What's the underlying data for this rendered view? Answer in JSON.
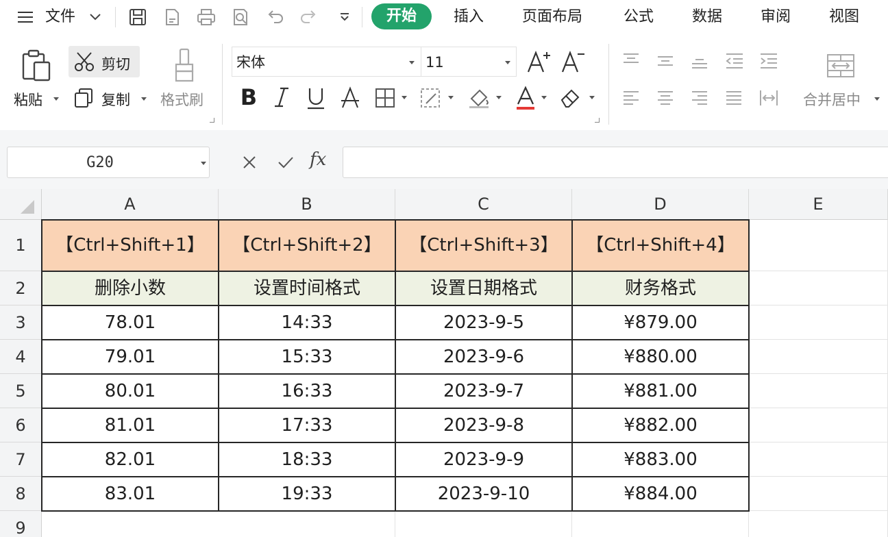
{
  "menu": {
    "file_label": "文件",
    "tabs": [
      "开始",
      "插入",
      "页面布局",
      "公式",
      "数据",
      "审阅",
      "视图"
    ],
    "active_tab": "开始"
  },
  "ribbon": {
    "paste_label": "粘贴",
    "cut_label": "剪切",
    "copy_label": "复制",
    "format_painter_label": "格式刷",
    "font_name": "宋体",
    "font_size": "11",
    "merge_label": "合并居中",
    "font_color": "#e53935",
    "accent": "#23a36b"
  },
  "formula_bar": {
    "cell_ref": "G20",
    "fx_label": "fx",
    "value": ""
  },
  "sheet": {
    "columns": [
      "A",
      "B",
      "C",
      "D",
      "E"
    ],
    "rows": [
      "1",
      "2",
      "3",
      "4",
      "5",
      "6",
      "7",
      "8",
      "9"
    ],
    "header_row": [
      "【Ctrl+Shift+1】",
      "【Ctrl+Shift+2】",
      "【Ctrl+Shift+3】",
      "【Ctrl+Shift+4】"
    ],
    "subheader_row": [
      "删除小数",
      "设置时间格式",
      "设置日期格式",
      "财务格式"
    ],
    "data_rows": [
      [
        "78.01",
        "14:33",
        "2023-9-5",
        "¥879.00"
      ],
      [
        "79.01",
        "15:33",
        "2023-9-6",
        "¥880.00"
      ],
      [
        "80.01",
        "16:33",
        "2023-9-7",
        "¥881.00"
      ],
      [
        "81.01",
        "17:33",
        "2023-9-8",
        "¥882.00"
      ],
      [
        "82.01",
        "18:33",
        "2023-9-9",
        "¥883.00"
      ],
      [
        "83.01",
        "19:33",
        "2023-9-10",
        "¥884.00"
      ]
    ],
    "header_fill": "#fad3b5",
    "subheader_fill": "#eef2e3"
  }
}
